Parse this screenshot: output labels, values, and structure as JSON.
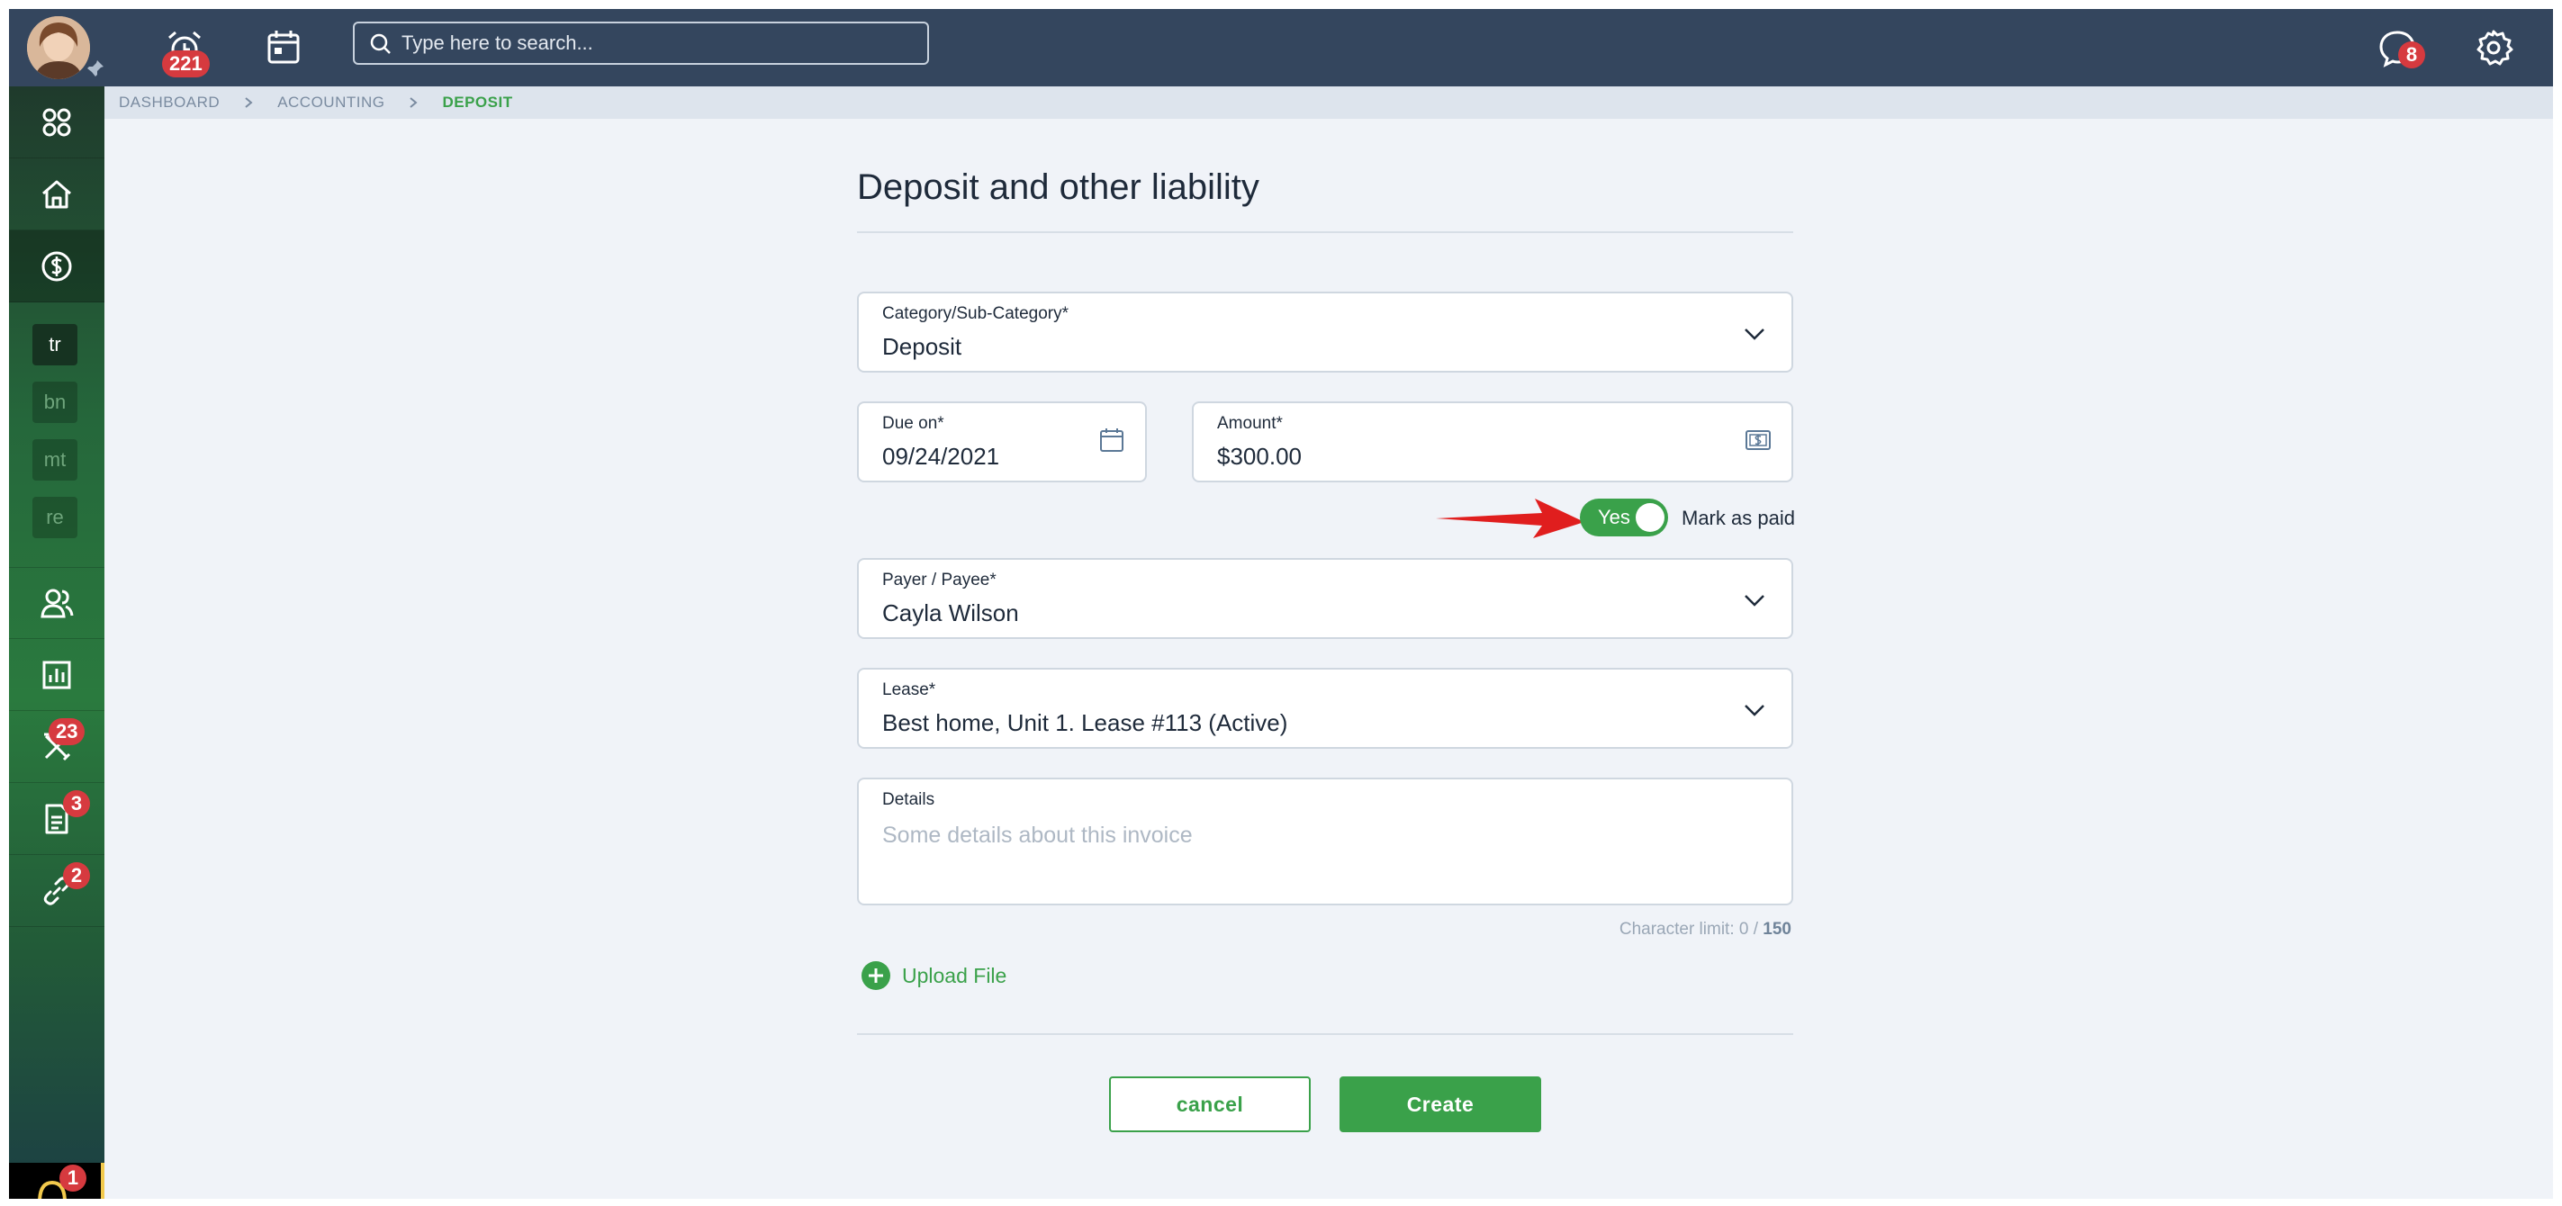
{
  "topbar": {
    "alarm_badge": "221",
    "search_placeholder": "Type here to search...",
    "notifications_badge": "8"
  },
  "sidebar": {
    "sub_items": [
      "tr",
      "bn",
      "mt",
      "re"
    ],
    "badges": {
      "maintenance": "23",
      "documents": "3",
      "links": "2",
      "bottom": "1"
    }
  },
  "breadcrumb": [
    "DASHBOARD",
    "ACCOUNTING",
    "DEPOSIT"
  ],
  "form": {
    "title": "Deposit and other liability",
    "category": {
      "label": "Category/Sub-Category*",
      "value": "Deposit"
    },
    "due_on": {
      "label": "Due on*",
      "value": "09/24/2021"
    },
    "amount": {
      "label": "Amount*",
      "value": "$300.00"
    },
    "mark_as_paid": {
      "toggle_text": "Yes",
      "label": "Mark as paid",
      "on": true
    },
    "payer": {
      "label": "Payer / Payee*",
      "value": "Cayla Wilson"
    },
    "lease": {
      "label": "Lease*",
      "value": "Best home, Unit 1. Lease #113 (Active)"
    },
    "details": {
      "label": "Details",
      "placeholder": "Some details about this invoice"
    },
    "char_limit": {
      "prefix": "Character limit: 0 / ",
      "max": "150"
    },
    "upload_label": "Upload File",
    "cancel_label": "cancel",
    "create_label": "Create"
  },
  "colors": {
    "topbar": "#34465e",
    "accent": "#3aa14a",
    "badge": "#d63a3f",
    "background": "#f0f3f8"
  }
}
